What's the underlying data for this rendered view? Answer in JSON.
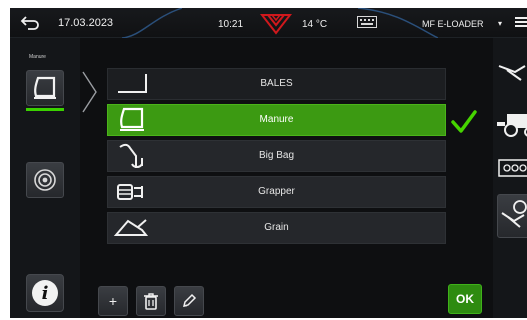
{
  "status_bar": {
    "date": "17.03.2023",
    "time": "10:21",
    "temperature": "14 °C",
    "model": "MF E-LOADER",
    "model_caret": "▾",
    "brand_color": "#d0181c"
  },
  "left_rail": {
    "active_label": "Manure",
    "active_indicator_color": "#3bd100",
    "buttons": [
      "bucket-icon",
      "target-icon",
      "info-icon"
    ],
    "info_glyph": "i"
  },
  "tool_list": {
    "items": [
      {
        "label": "BALES",
        "icon": "bale-fork-icon",
        "selected": false
      },
      {
        "label": "Manure",
        "icon": "manure-bucket-icon",
        "selected": true
      },
      {
        "label": "Big Bag",
        "icon": "big-bag-hook-icon",
        "selected": false
      },
      {
        "label": "Grapper",
        "icon": "grapple-icon",
        "selected": false
      },
      {
        "label": "Grain",
        "icon": "grain-bucket-icon",
        "selected": false
      }
    ],
    "selected_color": "#3c9a12",
    "check_color": "#46d400"
  },
  "right_rail": {
    "icons": [
      "loader-arm-icon",
      "tractor-icon",
      "keypad-icon",
      "loader-settings-icon"
    ]
  },
  "toolbar": {
    "add_label": "+",
    "delete_icon": "trash-icon",
    "edit_icon": "pencil-icon",
    "ok_label": "OK"
  }
}
